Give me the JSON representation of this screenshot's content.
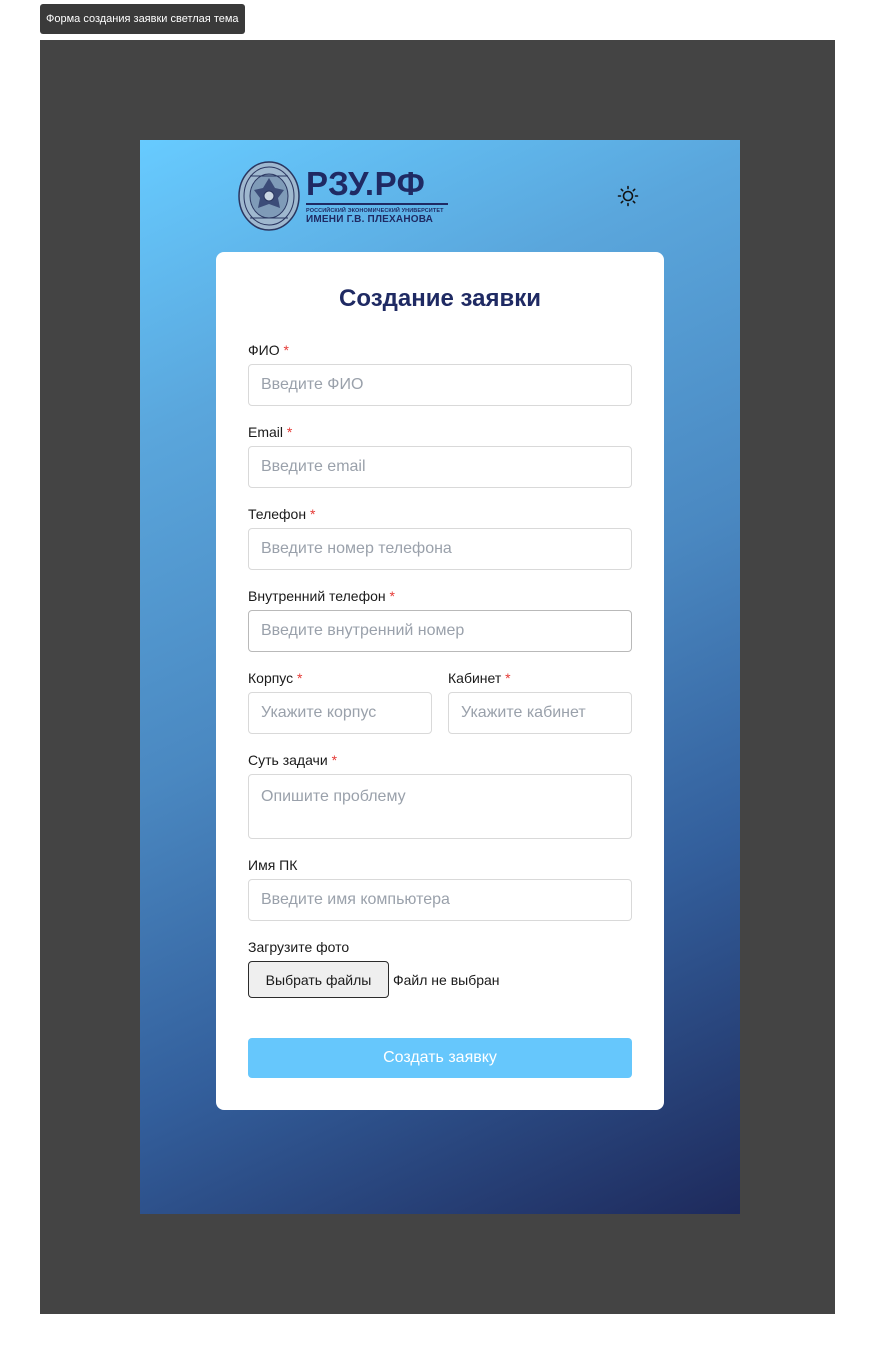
{
  "frame": {
    "tag": "Форма создания заявки светлая тема"
  },
  "header": {
    "logo": {
      "name": "РЗУ.РФ",
      "subtitle_line1": "РОССИЙСКИЙ ЭКОНОМИЧЕСКИЙ УНИВЕРСИТЕТ",
      "subtitle_line2": "ИМЕНИ Г.В. ПЛЕХАНОВА"
    },
    "theme_toggle_icon": "sun-icon"
  },
  "form": {
    "title": "Создание заявки",
    "required_mark": "*",
    "fields": {
      "fio": {
        "label": "ФИО",
        "placeholder": "Введите ФИО"
      },
      "email": {
        "label": "Email",
        "placeholder": "Введите email"
      },
      "phone": {
        "label": "Телефон",
        "placeholder": "Введите номер телефона"
      },
      "internal_phone": {
        "label": "Внутренний телефон",
        "placeholder": "Введите внутренний номер"
      },
      "building": {
        "label": "Корпус",
        "placeholder": "Укажите корпус"
      },
      "office": {
        "label": "Кабинет",
        "placeholder": "Укажите кабинет"
      },
      "task": {
        "label": "Суть задачи",
        "placeholder": "Опишите проблему"
      },
      "pc_name": {
        "label": "Имя ПК",
        "placeholder": "Введите имя компьютера"
      }
    },
    "upload": {
      "label": "Загрузите фото",
      "button": "Выбрать файлы",
      "status": "Файл не выбран"
    },
    "submit": "Создать заявку"
  },
  "colors": {
    "frame_background": "#444444",
    "gradient_start": "#67cbff",
    "gradient_end": "#1e2a5c",
    "brand_navy": "#1f2a63",
    "required": "#e53935",
    "submit": "#66c7fc"
  }
}
